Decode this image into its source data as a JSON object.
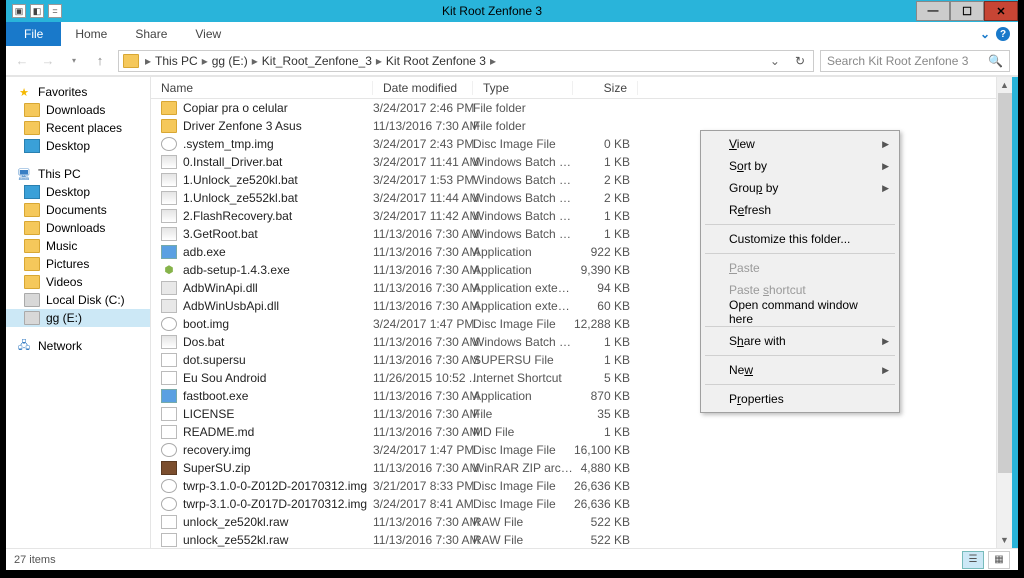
{
  "window": {
    "title": "Kit Root Zenfone 3"
  },
  "ribbon": {
    "file": "File",
    "home": "Home",
    "share": "Share",
    "view": "View"
  },
  "breadcrumb": [
    "This PC",
    "gg (E:)",
    "Kit_Root_Zenfone_3",
    "Kit Root Zenfone 3"
  ],
  "search": {
    "placeholder": "Search Kit Root Zenfone 3"
  },
  "columns": {
    "name": "Name",
    "date": "Date modified",
    "type": "Type",
    "size": "Size"
  },
  "nav": {
    "favorites": "Favorites",
    "fav_items": [
      "Downloads",
      "Recent places",
      "Desktop"
    ],
    "thispc": "This PC",
    "pc_items": [
      "Desktop",
      "Documents",
      "Downloads",
      "Music",
      "Pictures",
      "Videos",
      "Local Disk (C:)",
      "gg (E:)"
    ],
    "network": "Network"
  },
  "files": [
    {
      "ic": "folder",
      "n": "Copiar pra o celular",
      "d": "3/24/2017 2:46 PM",
      "t": "File folder",
      "s": ""
    },
    {
      "ic": "folder",
      "n": "Driver Zenfone 3 Asus",
      "d": "11/13/2016 7:30 AM",
      "t": "File folder",
      "s": ""
    },
    {
      "ic": "disc",
      "n": ".system_tmp.img",
      "d": "3/24/2017 2:43 PM",
      "t": "Disc Image File",
      "s": "0 KB"
    },
    {
      "ic": "bat",
      "n": "0.Install_Driver.bat",
      "d": "3/24/2017 11:41 AM",
      "t": "Windows Batch File",
      "s": "1 KB"
    },
    {
      "ic": "bat",
      "n": "1.Unlock_ze520kl.bat",
      "d": "3/24/2017 1:53 PM",
      "t": "Windows Batch File",
      "s": "2 KB"
    },
    {
      "ic": "bat",
      "n": "1.Unlock_ze552kl.bat",
      "d": "3/24/2017 11:44 AM",
      "t": "Windows Batch File",
      "s": "2 KB"
    },
    {
      "ic": "bat",
      "n": "2.FlashRecovery.bat",
      "d": "3/24/2017 11:42 AM",
      "t": "Windows Batch File",
      "s": "1 KB"
    },
    {
      "ic": "bat",
      "n": "3.GetRoot.bat",
      "d": "11/13/2016 7:30 AM",
      "t": "Windows Batch File",
      "s": "1 KB"
    },
    {
      "ic": "exe",
      "n": "adb.exe",
      "d": "11/13/2016 7:30 AM",
      "t": "Application",
      "s": "922 KB"
    },
    {
      "ic": "android",
      "n": "adb-setup-1.4.3.exe",
      "d": "11/13/2016 7:30 AM",
      "t": "Application",
      "s": "9,390 KB"
    },
    {
      "ic": "dll",
      "n": "AdbWinApi.dll",
      "d": "11/13/2016 7:30 AM",
      "t": "Application extens...",
      "s": "94 KB"
    },
    {
      "ic": "dll",
      "n": "AdbWinUsbApi.dll",
      "d": "11/13/2016 7:30 AM",
      "t": "Application extens...",
      "s": "60 KB"
    },
    {
      "ic": "disc",
      "n": "boot.img",
      "d": "3/24/2017 1:47 PM",
      "t": "Disc Image File",
      "s": "12,288 KB"
    },
    {
      "ic": "bat",
      "n": "Dos.bat",
      "d": "11/13/2016 7:30 AM",
      "t": "Windows Batch File",
      "s": "1 KB"
    },
    {
      "ic": "txt",
      "n": "dot.supersu",
      "d": "11/13/2016 7:30 AM",
      "t": "SUPERSU File",
      "s": "1 KB"
    },
    {
      "ic": "url",
      "n": "Eu Sou Android",
      "d": "11/26/2015 10:52 ...",
      "t": "Internet Shortcut",
      "s": "5 KB"
    },
    {
      "ic": "exe",
      "n": "fastboot.exe",
      "d": "11/13/2016 7:30 AM",
      "t": "Application",
      "s": "870 KB"
    },
    {
      "ic": "txt",
      "n": "LICENSE",
      "d": "11/13/2016 7:30 AM",
      "t": "File",
      "s": "35 KB"
    },
    {
      "ic": "txt",
      "n": "README.md",
      "d": "11/13/2016 7:30 AM",
      "t": "MD File",
      "s": "1 KB"
    },
    {
      "ic": "disc",
      "n": "recovery.img",
      "d": "3/24/2017 1:47 PM",
      "t": "Disc Image File",
      "s": "16,100 KB"
    },
    {
      "ic": "zip",
      "n": "SuperSU.zip",
      "d": "11/13/2016 7:30 AM",
      "t": "WinRAR ZIP archive",
      "s": "4,880 KB"
    },
    {
      "ic": "disc",
      "n": "twrp-3.1.0-0-Z012D-20170312.img",
      "d": "3/21/2017 8:33 PM",
      "t": "Disc Image File",
      "s": "26,636 KB"
    },
    {
      "ic": "disc",
      "n": "twrp-3.1.0-0-Z017D-20170312.img",
      "d": "3/24/2017 8:41 AM",
      "t": "Disc Image File",
      "s": "26,636 KB"
    },
    {
      "ic": "txt",
      "n": "unlock_ze520kl.raw",
      "d": "11/13/2016 7:30 AM",
      "t": "RAW File",
      "s": "522 KB"
    },
    {
      "ic": "txt",
      "n": "unlock_ze552kl.raw",
      "d": "11/13/2016 7:30 AM",
      "t": "RAW File",
      "s": "522 KB"
    }
  ],
  "status": {
    "count": "27 items"
  },
  "ctx": {
    "view": "View",
    "sort": "Sort by",
    "group": "Group by",
    "refresh": "Refresh",
    "customize": "Customize this folder...",
    "paste": "Paste",
    "paste_shortcut": "Paste shortcut",
    "open_cmd": "Open command window here",
    "share": "Share with",
    "new": "New",
    "properties": "Properties"
  }
}
